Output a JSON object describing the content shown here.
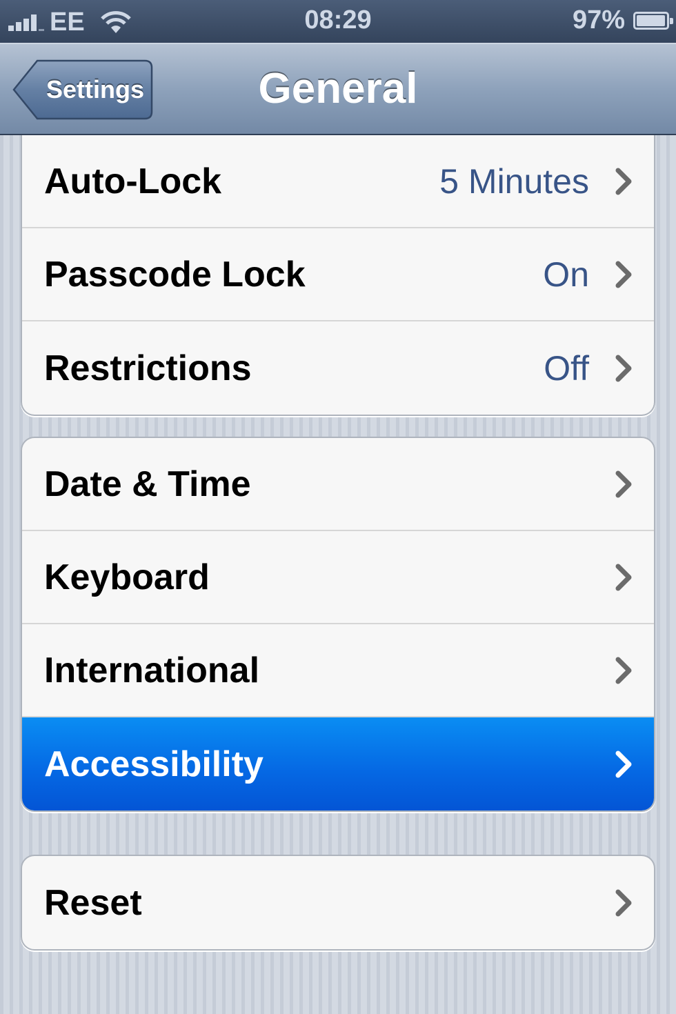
{
  "status_bar": {
    "carrier": "EE",
    "time": "08:29",
    "battery": "97%",
    "battery_level": 0.97,
    "signal_icon": "signal-bars-icon",
    "wifi_icon": "wifi-icon",
    "battery_icon": "battery-icon"
  },
  "nav": {
    "back_label": "Settings",
    "title": "General"
  },
  "groups": [
    {
      "rows": [
        {
          "label": "Auto-Lock",
          "value": "5 Minutes"
        },
        {
          "label": "Passcode Lock",
          "value": "On"
        },
        {
          "label": "Restrictions",
          "value": "Off"
        }
      ]
    },
    {
      "rows": [
        {
          "label": "Date & Time"
        },
        {
          "label": "Keyboard"
        },
        {
          "label": "International"
        },
        {
          "label": "Accessibility",
          "selected": true
        }
      ]
    },
    {
      "rows": [
        {
          "label": "Reset"
        }
      ]
    }
  ],
  "colors": {
    "nav_bar": "#8ea2bb",
    "value_text": "#385487",
    "selection": "#0567e3",
    "cell_background": "#f7f7f7"
  }
}
